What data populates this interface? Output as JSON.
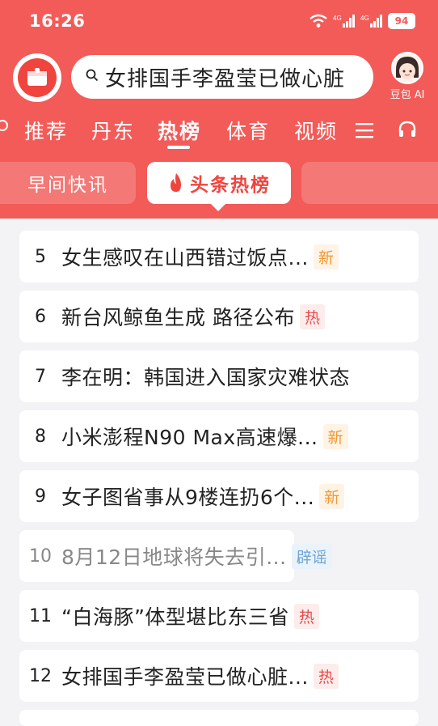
{
  "status_bar": {
    "time": "16:26",
    "battery": "94",
    "network_1": "4G",
    "network_2": "4G"
  },
  "search": {
    "query": "女排国手李盈莹已做心脏"
  },
  "assistant": {
    "label": "豆包 AI"
  },
  "tabs": [
    {
      "label": "推荐"
    },
    {
      "label": "丹东"
    },
    {
      "label": "热榜"
    },
    {
      "label": "体育"
    },
    {
      "label": "视频"
    }
  ],
  "subtabs": [
    {
      "label": "早间快讯"
    },
    {
      "label": "头条热榜"
    }
  ],
  "items": [
    {
      "rank": "5",
      "title": "女生感叹在山西错过饭点...",
      "tag": "新",
      "tag_type": "new"
    },
    {
      "rank": "6",
      "title": "新台风鲸鱼生成 路径公布",
      "tag": "热",
      "tag_type": "hot"
    },
    {
      "rank": "7",
      "title": "李在明：韩国进入国家灾难状态",
      "tag": "",
      "tag_type": ""
    },
    {
      "rank": "8",
      "title": "小米澎程N90 Max高速爆...",
      "tag": "新",
      "tag_type": "new"
    },
    {
      "rank": "9",
      "title": "女子图省事从9楼连扔6个...",
      "tag": "新",
      "tag_type": "new"
    },
    {
      "rank": "10",
      "title": "8月12日地球将失去引...",
      "tag": "辟谣",
      "tag_type": "rumor"
    },
    {
      "rank": "11",
      "title": "“白海豚”体型堪比东三省",
      "tag": "热",
      "tag_type": "hot"
    },
    {
      "rank": "12",
      "title": "女排国手李盈莹已做心脏...",
      "tag": "热",
      "tag_type": "hot"
    }
  ],
  "colors": {
    "brand": "#f25b58",
    "new_tag": "#f09a36",
    "hot_tag": "#e84d4d",
    "rumor_tag": "#6fa6d8"
  },
  "icons": [
    "wifi-icon",
    "signal-icon",
    "battery-icon",
    "app-logo-icon",
    "search-icon",
    "avatar-icon",
    "menu-icon",
    "headphones-icon",
    "flame-icon"
  ]
}
